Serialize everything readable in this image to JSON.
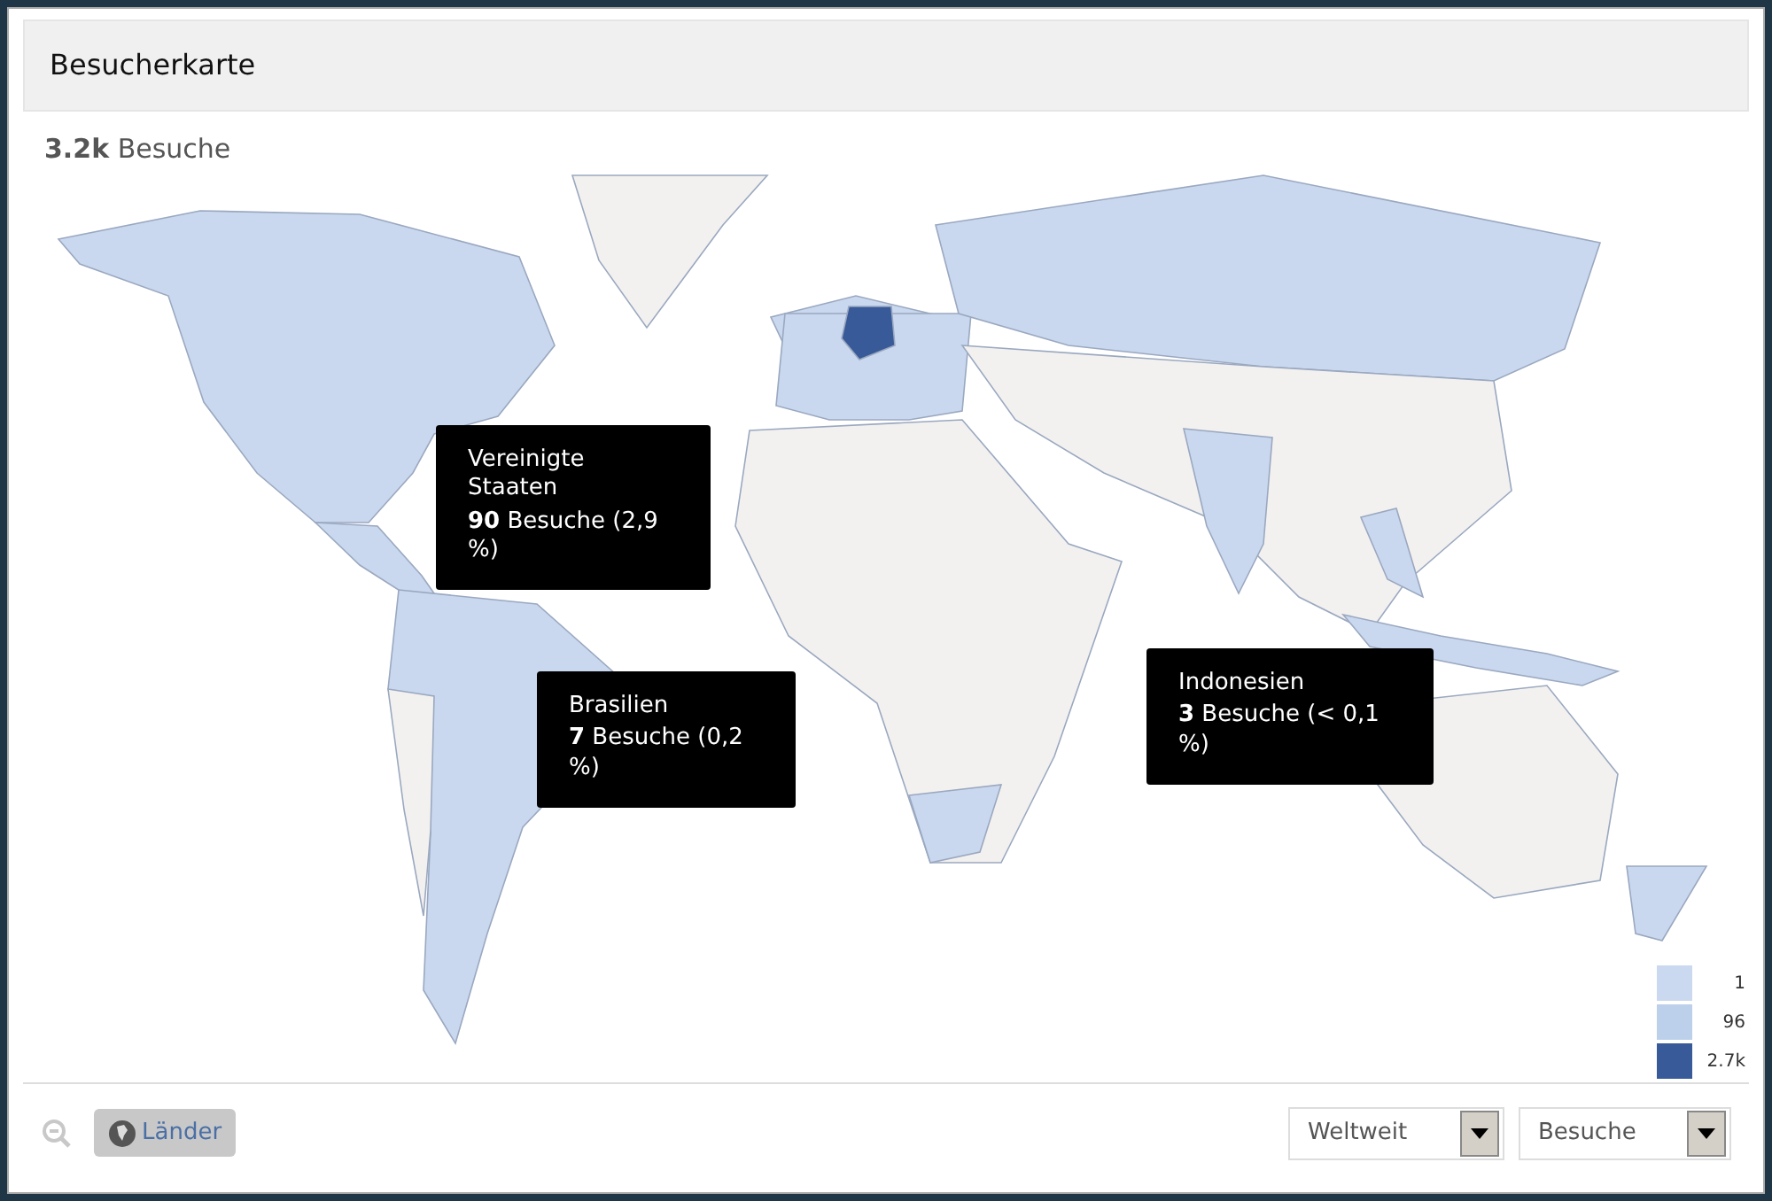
{
  "title": "Besucherkarte",
  "summary": {
    "value": "3.2k",
    "label": "Besuche"
  },
  "tooltips": [
    {
      "name": "Vereinigte Staaten",
      "stat": "**90** Besuche (2,9 %)"
    },
    {
      "name": "Brasilien",
      "stat": "**7** Besuche (0,2 %)"
    },
    {
      "name": "Indonesien",
      "stat": "**3** Besuche (< 0,1 %)"
    }
  ],
  "legend": [
    {
      "label": "1",
      "color": "#cad9ef"
    },
    {
      "label": "96",
      "color": "#bccfeb"
    },
    {
      "label": "2.7k",
      "color": "#385a98"
    }
  ],
  "footer": {
    "zoom_out": {
      "disabled": true
    },
    "countries_button": {
      "label": "Länder"
    },
    "dropdowns": [
      {
        "value": "Weltweit"
      },
      {
        "value": "Besuche"
      }
    ]
  }
}
